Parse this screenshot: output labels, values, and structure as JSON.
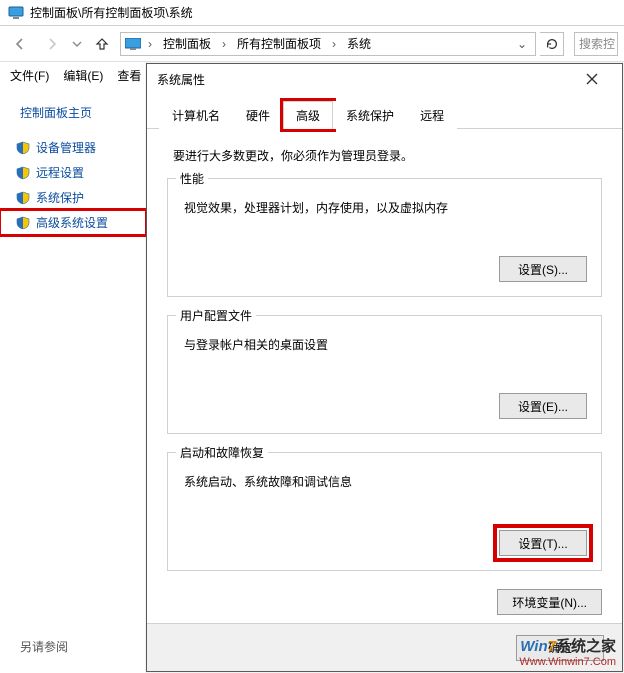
{
  "titlebar": {
    "path": "控制面板\\所有控制面板项\\系统"
  },
  "breadcrumbs": {
    "a": "控制面板",
    "b": "所有控制面板项",
    "c": "系统"
  },
  "search": {
    "placeholder": "搜索控"
  },
  "menu": {
    "file": "文件(F)",
    "edit": "编辑(E)",
    "view": "查看"
  },
  "sidebar": {
    "home": "控制面板主页",
    "items": [
      {
        "label": "设备管理器"
      },
      {
        "label": "远程设置"
      },
      {
        "label": "系统保护"
      },
      {
        "label": "高级系统设置"
      }
    ],
    "see_also": "另请参阅"
  },
  "dialog": {
    "title": "系统属性",
    "tabs": {
      "computer_name": "计算机名",
      "hardware": "硬件",
      "advanced": "高级",
      "system_protection": "系统保护",
      "remote": "远程"
    },
    "intro": "要进行大多数更改，你必须作为管理员登录。",
    "groups": {
      "performance": {
        "legend": "性能",
        "desc": "视觉效果，处理器计划，内存使用，以及虚拟内存",
        "button": "设置(S)..."
      },
      "profiles": {
        "legend": "用户配置文件",
        "desc": "与登录帐户相关的桌面设置",
        "button": "设置(E)..."
      },
      "startup": {
        "legend": "启动和故障恢复",
        "desc": "系统启动、系统故障和调试信息",
        "button": "设置(T)..."
      }
    },
    "env_button": "环境变量(N)...",
    "footer": {
      "ok": "确定"
    }
  },
  "watermark": {
    "line1a": "Win",
    "line1b": "7",
    "line1c": "系统之家",
    "line2": "Www.Winwin7.Com"
  }
}
